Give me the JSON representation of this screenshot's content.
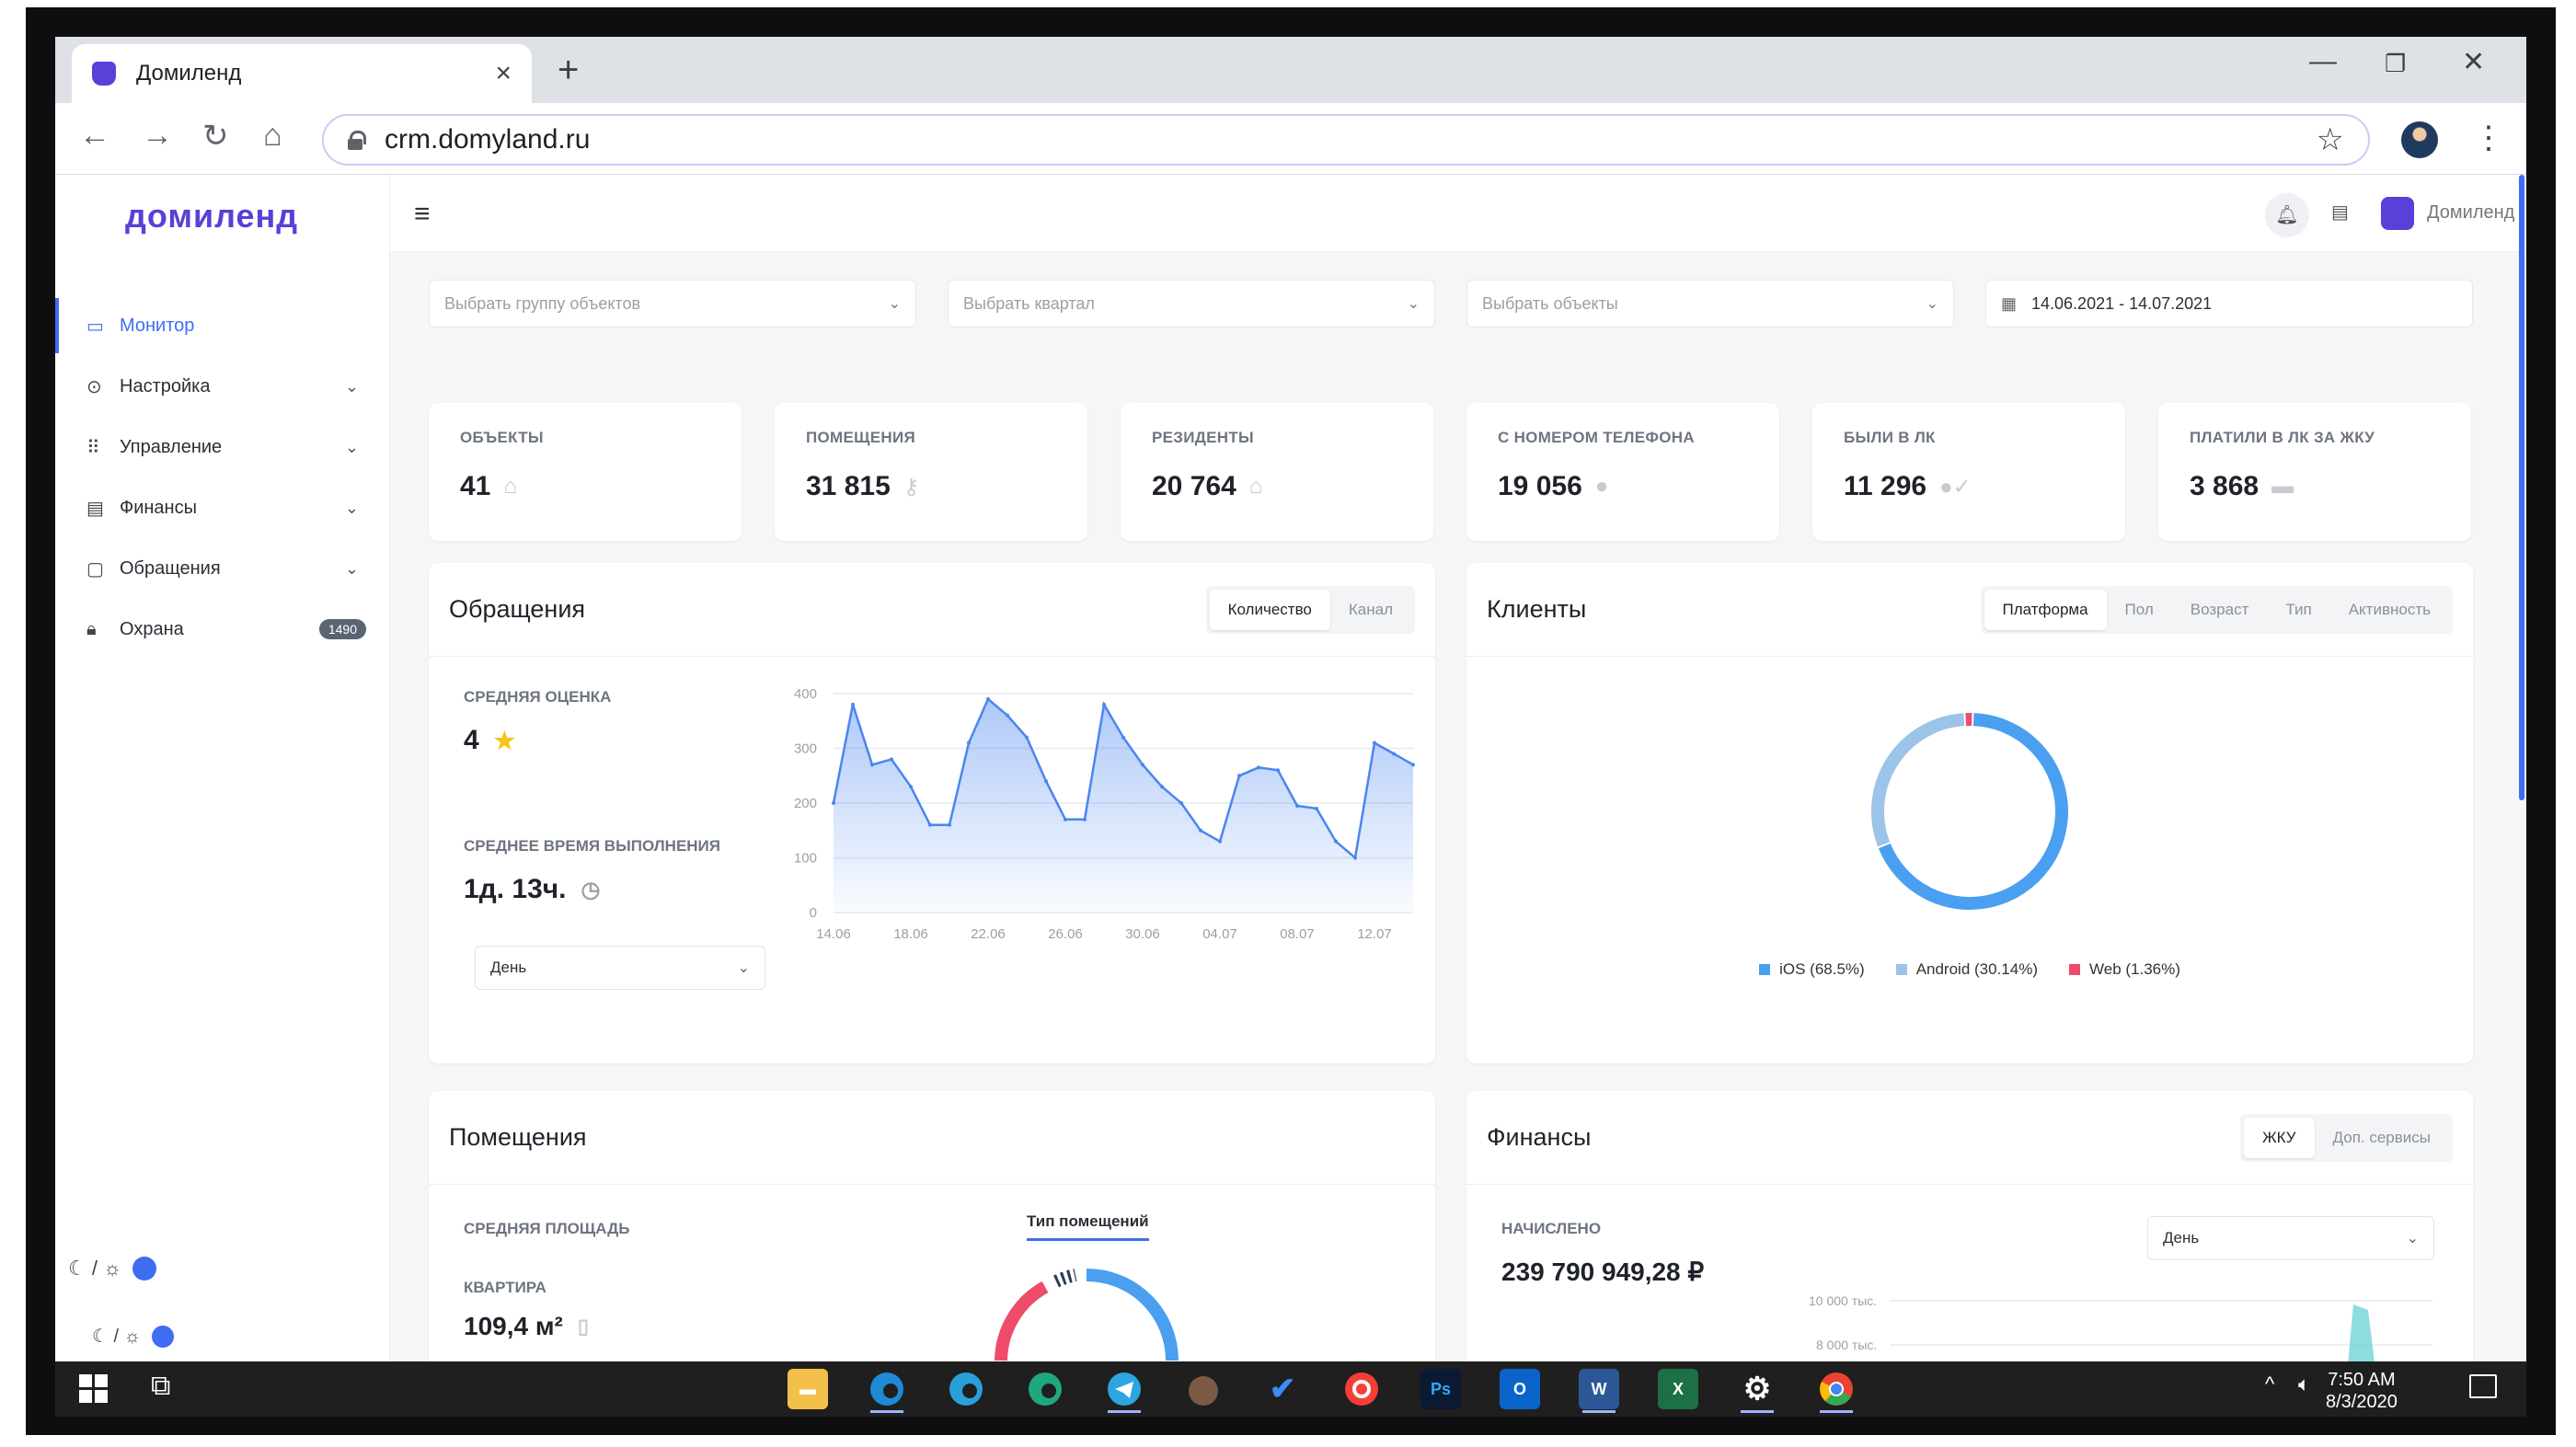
{
  "browser": {
    "tab_title": "Домиленд",
    "url": "crm.domyland.ru"
  },
  "app": {
    "logo": "домиленд",
    "user_name": "Домиленд"
  },
  "sidebar": {
    "items": [
      {
        "label": "Монитор",
        "icon": "monitor-icon",
        "active": true
      },
      {
        "label": "Настройка",
        "icon": "settings-icon",
        "chevron": true
      },
      {
        "label": "Управление",
        "icon": "grid-icon",
        "chevron": true
      },
      {
        "label": "Финансы",
        "icon": "card-icon",
        "chevron": true
      },
      {
        "label": "Обращения",
        "icon": "chat-icon",
        "chevron": true
      },
      {
        "label": "Охрана",
        "icon": "lock-icon",
        "badge": "1490"
      }
    ],
    "theme_toggle": "☾ / ☼"
  },
  "filters": {
    "group_placeholder": "Выбрать группу объектов",
    "quarter_placeholder": "Выбрать квартал",
    "objects_placeholder": "Выбрать объекты",
    "date_range": "14.06.2021 - 14.07.2021"
  },
  "stats": [
    {
      "label": "Объекты",
      "value": "41",
      "icon": "building-icon"
    },
    {
      "label": "Помещения",
      "value": "31 815",
      "icon": "key-icon"
    },
    {
      "label": "Резиденты",
      "value": "20 764",
      "icon": "home-icon"
    },
    {
      "label": "С номером телефона",
      "value": "19 056",
      "icon": "person-icon"
    },
    {
      "label": "Были в ЛК",
      "value": "11 296",
      "icon": "person-check-icon"
    },
    {
      "label": "Платили в ЛК за ЖКУ",
      "value": "3 868",
      "icon": "wallet-icon"
    }
  ],
  "requests_panel": {
    "title": "Обращения",
    "tabs": [
      "Количество",
      "Канал"
    ],
    "avg_rating_label": "Средняя оценка",
    "avg_rating_value": "4",
    "avg_time_label": "Среднее время выполнения",
    "avg_time_value": "1д. 13ч.",
    "period_select": "День"
  },
  "clients_panel": {
    "title": "Клиенты",
    "tabs": [
      "Платформа",
      "Пол",
      "Возраст",
      "Тип",
      "Активность"
    ],
    "legend": [
      {
        "label": "iOS (68.5%)",
        "color": "#4a9ff0"
      },
      {
        "label": "Android (30.14%)",
        "color": "#9cc3e8"
      },
      {
        "label": "Web (1.36%)",
        "color": "#ef4b6a"
      }
    ]
  },
  "premises_panel": {
    "title": "Помещения",
    "avg_area_label": "Средняя площадь",
    "type_tab": "Тип помещений",
    "apartment_label": "Квартира",
    "apartment_value": "109,4 м²"
  },
  "finance_panel": {
    "title": "Финансы",
    "tabs": [
      "ЖКУ",
      "Доп. сервисы"
    ],
    "accrued_label": "Начислено",
    "accrued_value": "239 790 949,28 ₽",
    "period_select": "День",
    "y_ticks": [
      "10 000 тыс.",
      "8 000 тыс."
    ]
  },
  "taskbar": {
    "time": "7:50 AM",
    "date": "8/3/2020",
    "apps": [
      "File Explorer",
      "Edge",
      "Edge Beta",
      "Edge Dev",
      "Telegram",
      "Bear",
      "Tasks",
      "Pocket Casts",
      "Ps",
      "Outlook",
      "Word",
      "Excel",
      "Settings",
      "Chrome"
    ]
  },
  "chart_data": [
    {
      "type": "area",
      "title": "",
      "x": [
        "14.06",
        "15.06",
        "16.06",
        "17.06",
        "18.06",
        "19.06",
        "20.06",
        "21.06",
        "22.06",
        "23.06",
        "24.06",
        "25.06",
        "26.06",
        "27.06",
        "28.06",
        "29.06",
        "30.06",
        "01.07",
        "02.07",
        "03.07",
        "04.07",
        "05.07",
        "06.07",
        "07.07",
        "08.07",
        "09.07",
        "10.07",
        "11.07",
        "12.07",
        "13.07",
        "14.07"
      ],
      "xticks": [
        "14.06",
        "18.06",
        "22.06",
        "26.06",
        "30.06",
        "04.07",
        "08.07",
        "12.07"
      ],
      "values": [
        200,
        380,
        270,
        280,
        230,
        160,
        160,
        310,
        390,
        360,
        320,
        240,
        170,
        170,
        380,
        320,
        270,
        230,
        200,
        150,
        130,
        250,
        265,
        260,
        195,
        190,
        130,
        100,
        310,
        290,
        270
      ],
      "ylim": [
        0,
        400
      ],
      "yticks": [
        0,
        100,
        200,
        300,
        400
      ],
      "color": "#4a86f0",
      "grid": true
    },
    {
      "type": "pie",
      "variant": "donut",
      "title": "",
      "series": [
        {
          "name": "iOS",
          "value": 68.5,
          "color": "#4a9ff0"
        },
        {
          "name": "Android",
          "value": 30.14,
          "color": "#9cc3e8"
        },
        {
          "name": "Web",
          "value": 1.36,
          "color": "#ef4b6a"
        }
      ]
    }
  ]
}
